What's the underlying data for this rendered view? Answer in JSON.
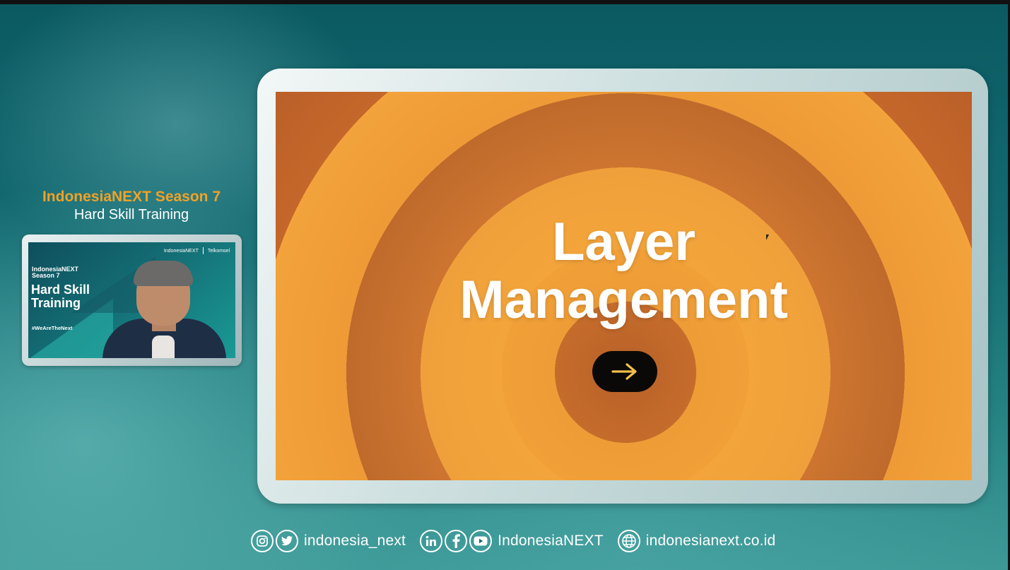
{
  "event": {
    "name": "IndonesiaNEXT Season 7",
    "subtitle": "Hard Skill Training"
  },
  "camera_feed": {
    "logo_left": "IndonesiaNEXT",
    "logo_right": "Telkomsel",
    "season_line1": "IndonesiaNEXT",
    "season_line2": "Season 7",
    "title": "Hard Skill Training",
    "hashtag": "#WeAreTheNext"
  },
  "slide": {
    "title_line1": "Layer",
    "title_line2": "Management",
    "next_icon": "arrow-right-icon",
    "colors": {
      "orange": "#f3a43a",
      "dark_orange": "#c4672b",
      "button": "#0b0907",
      "arrow": "#f2c04a"
    }
  },
  "footer": {
    "social_handle": "indonesia_next",
    "social_name": "IndonesiaNEXT",
    "website": "indonesianext.co.id",
    "icons": [
      "instagram-icon",
      "twitter-icon",
      "linkedin-icon",
      "facebook-icon",
      "youtube-icon",
      "globe-icon"
    ]
  },
  "colors": {
    "accent": "#f2a126",
    "teal_dark": "#0b5a62",
    "teal_light": "#3a9794"
  }
}
